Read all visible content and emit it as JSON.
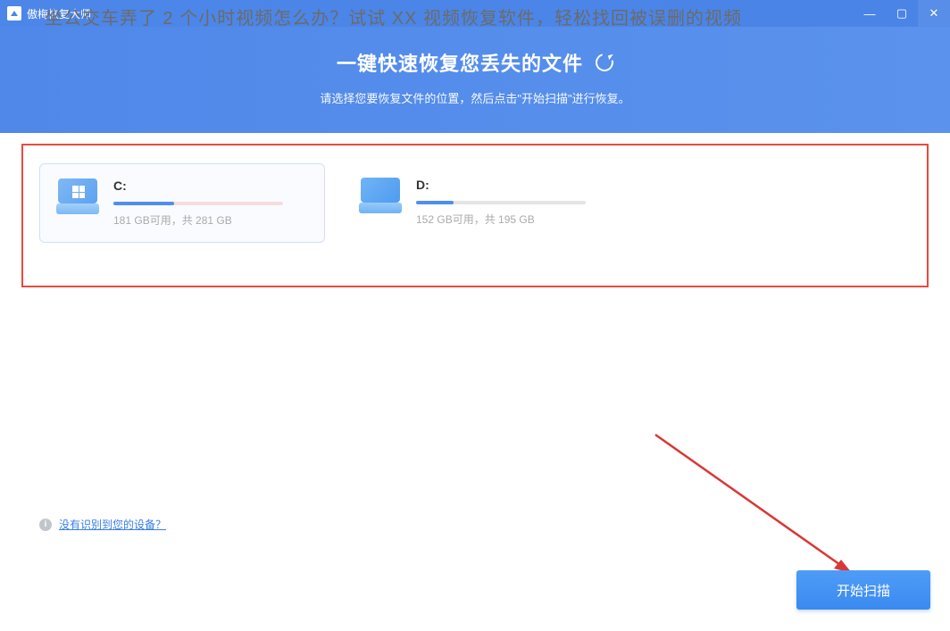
{
  "overlay_text": "坐公交车弄了 2 个小时视频怎么办？试试 XX 视频恢复软件，轻松找回被误删的视频",
  "titlebar": {
    "app_name": "傲梅恢复大师",
    "min": "—",
    "max": "▢",
    "close": "✕"
  },
  "header": {
    "title": "一键快速恢复您丢失的文件",
    "subtitle": "请选择您要恢复文件的位置，然后点击\"开始扫描\"进行恢复。"
  },
  "drives": [
    {
      "letter": "C:",
      "stats": "181 GB可用，共 281 GB",
      "selected": true,
      "type": "c"
    },
    {
      "letter": "D:",
      "stats": "152 GB可用，共 195 GB",
      "selected": false,
      "type": "d"
    }
  ],
  "bottom": {
    "info_glyph": "i",
    "device_link": "没有识别到您的设备？",
    "scan_button": "开始扫描"
  }
}
